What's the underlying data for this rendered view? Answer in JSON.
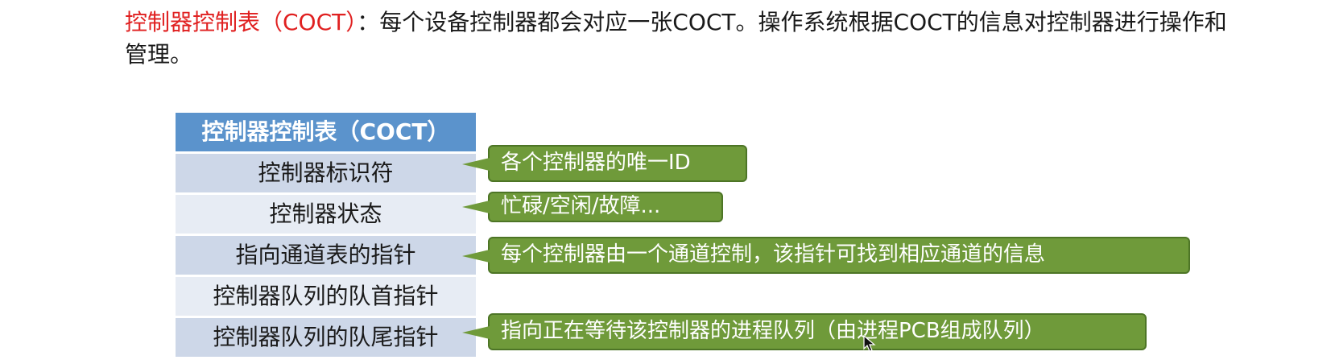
{
  "description": {
    "term": "控制器控制表（COCT）",
    "colon": "：",
    "text": "每个设备控制器都会对应一张COCT。操作系统根据COCT的信息对控制器进行操作和管理。"
  },
  "table": {
    "header": "控制器控制表（COCT）",
    "rows": [
      "控制器标识符",
      "控制器状态",
      "指向通道表的指针",
      "控制器队列的队首指针",
      "控制器队列的队尾指针"
    ]
  },
  "callouts": [
    "各个控制器的唯一ID",
    "忙碌/空闲/故障...",
    "每个控制器由一个通道控制，该指针可找到相应通道的信息",
    "指向正在等待该控制器的进程队列（由进程PCB组成队列）"
  ],
  "colors": {
    "term": "#e02020",
    "header_bg": "#5b93cc",
    "row_dark": "#cdd7e8",
    "row_light": "#e7ecf4",
    "callout_bg": "#6f9a3a"
  }
}
